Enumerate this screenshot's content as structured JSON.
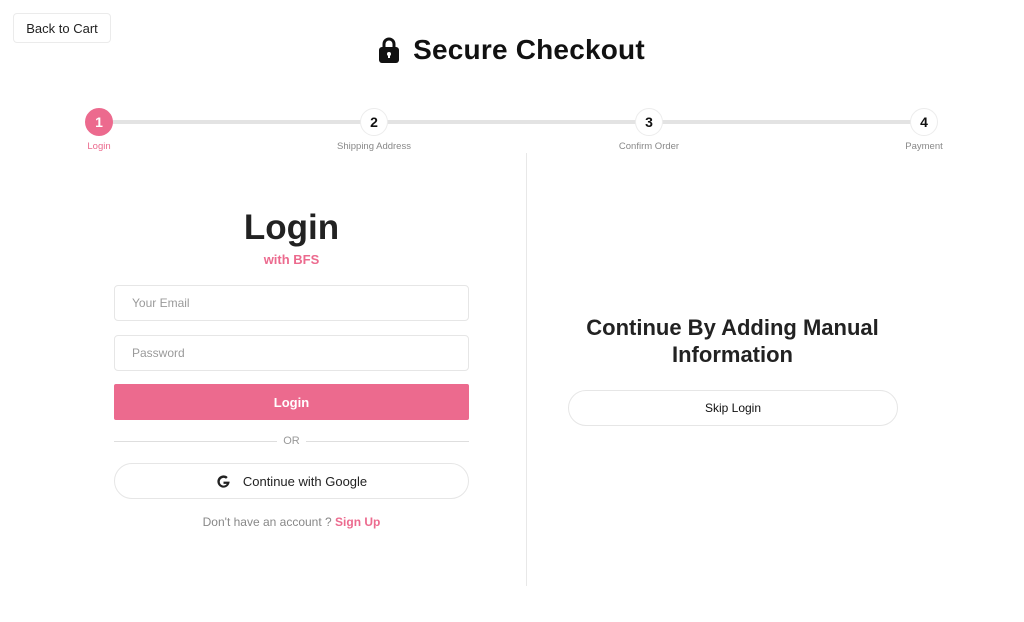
{
  "back_button": {
    "label": "Back to Cart"
  },
  "header": {
    "title": "Secure Checkout",
    "icon": "lock-icon"
  },
  "stepper": {
    "active_step": 1,
    "steps": [
      {
        "number": "1",
        "label": "Login"
      },
      {
        "number": "2",
        "label": "Shipping Address"
      },
      {
        "number": "3",
        "label": "Confirm Order"
      },
      {
        "number": "4",
        "label": "Payment"
      }
    ]
  },
  "login": {
    "title": "Login",
    "subtitle": "with BFS",
    "email_placeholder": "Your Email",
    "email_value": "",
    "password_placeholder": "Password",
    "password_value": "",
    "login_button": "Login",
    "or_text": "OR",
    "google_button": "Continue with Google",
    "google_icon": "google-icon",
    "signup_prompt": "Don't have an account ?",
    "signup_link": "Sign Up"
  },
  "manual": {
    "title": "Continue By Adding Manual Information",
    "skip_button": "Skip Login"
  },
  "colors": {
    "accent": "#ec6a8e",
    "border": "#e6e6e6",
    "track": "#e3e3e3"
  }
}
